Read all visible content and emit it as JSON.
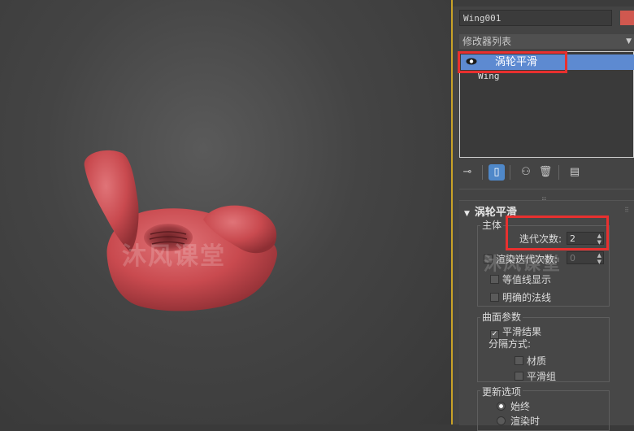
{
  "viewport": {
    "object": "wing-nut-3d-model",
    "object_color": "#c94a4f",
    "watermark": "沐风课堂"
  },
  "panel": {
    "object_name": "Wing001",
    "object_color": "#d0584f",
    "modifier_list_label": "修改器列表",
    "stack": {
      "selected_modifier": "涡轮平滑",
      "base_object": "Wing"
    },
    "toolbar": [
      {
        "name": "pin-stack-icon",
        "glyph": "📌"
      },
      {
        "name": "show-end-result-icon",
        "glyph": "▯"
      },
      {
        "name": "make-unique-icon",
        "glyph": "⚇"
      },
      {
        "name": "remove-modifier-icon",
        "glyph": "🗑"
      },
      {
        "name": "configure-modifier-sets-icon",
        "glyph": "▤"
      }
    ],
    "rollout": {
      "title": "涡轮平滑",
      "main_group": {
        "label": "主体",
        "iterations_label": "迭代次数:",
        "iterations_value": "2",
        "render_iterations_label": "渲染迭代次数:",
        "render_iterations_value": "0",
        "isoline_display": "等值线显示",
        "explicit_normals": "明确的法线"
      },
      "surface_group": {
        "label": "曲面参数",
        "smooth_result": "平滑结果",
        "separate_by": "分隔方式:",
        "materials": "材质",
        "smoothing_groups": "平滑组"
      },
      "update_group": {
        "label": "更新选项",
        "always": "始终",
        "when_rendering": "渲染时"
      }
    },
    "watermark": "沐风课堂"
  },
  "highlight_color": "#e8302f",
  "selection_color": "#5d8ad1"
}
